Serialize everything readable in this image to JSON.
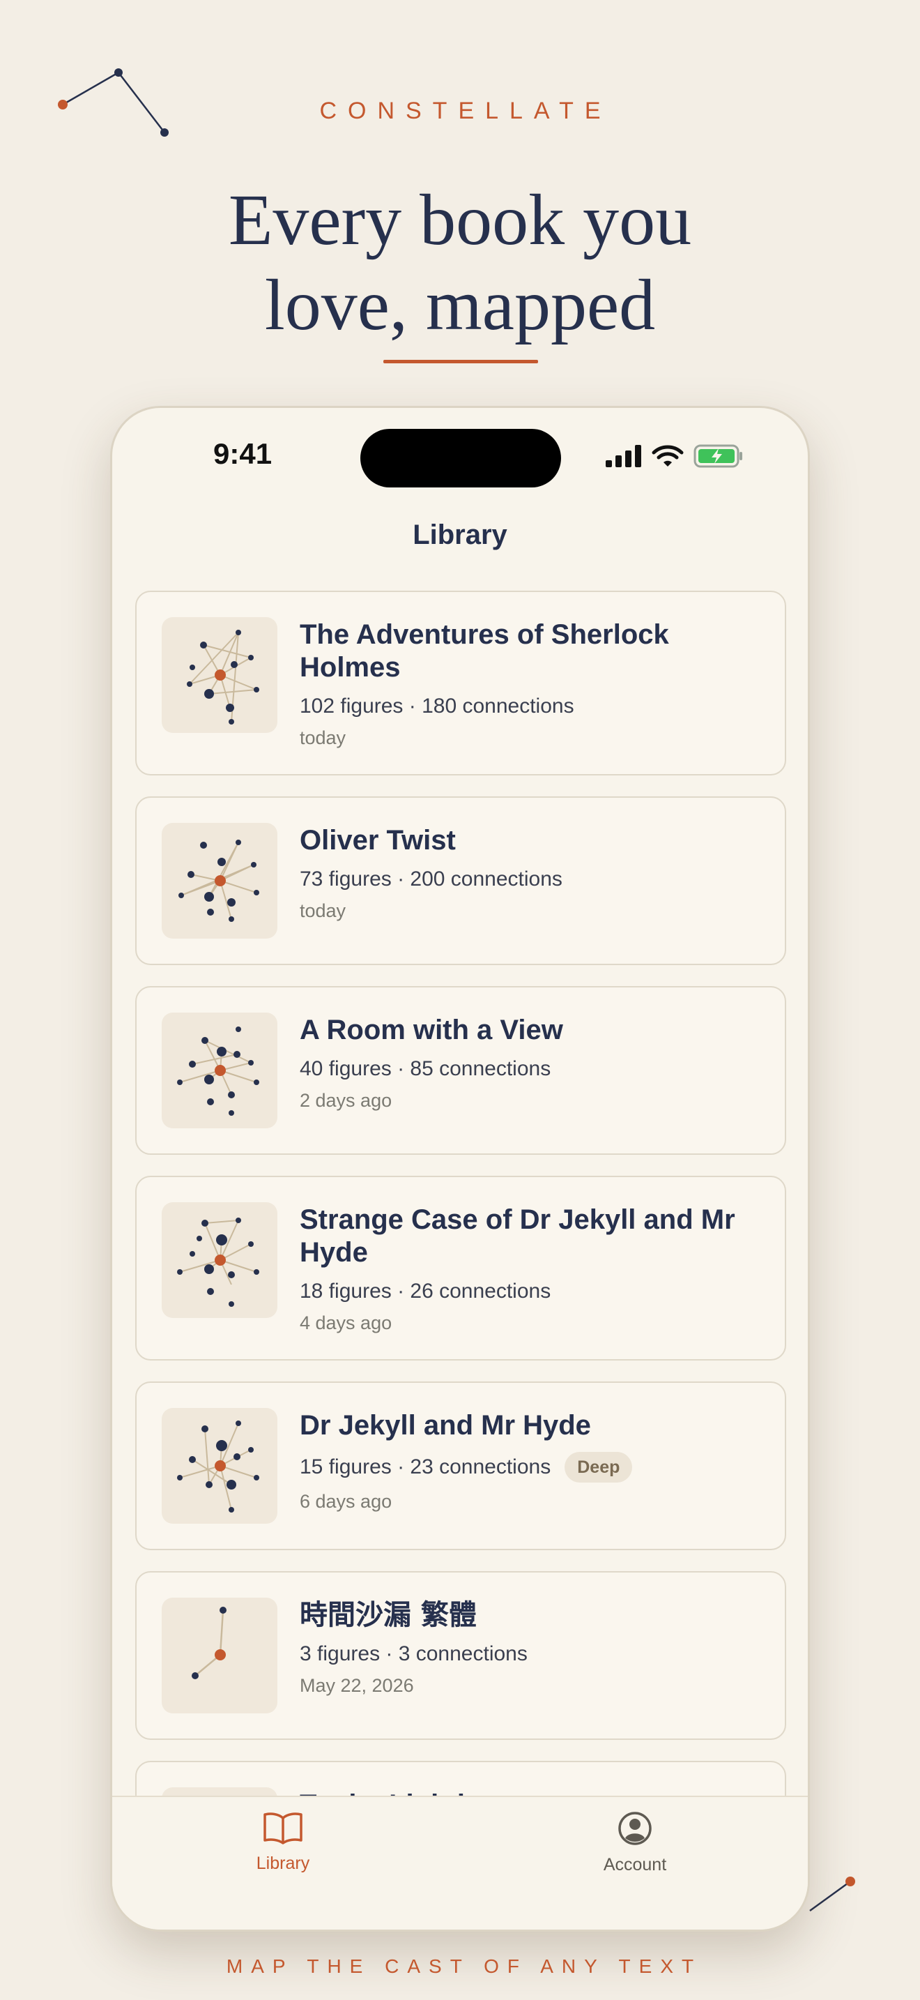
{
  "brand": "CONSTELLATE",
  "headline": {
    "line1": "Every book you",
    "line2": "love, mapped"
  },
  "tagline": "MAP THE CAST OF ANY TEXT",
  "status": {
    "time": "9:41"
  },
  "screen": {
    "title": "Library"
  },
  "books": [
    {
      "title": "The Adventures of Sherlock Holmes",
      "stats": "102 figures · 180 connections",
      "when": "today",
      "thumb": "constellation-dense"
    },
    {
      "title": "Oliver Twist",
      "stats": "73 figures · 200 connections",
      "when": "today",
      "thumb": "constellation-dense"
    },
    {
      "title": "A Room with a View",
      "stats": "40 figures · 85 connections",
      "when": "2 days ago",
      "thumb": "constellation-dense"
    },
    {
      "title": "Strange Case of Dr Jekyll and Mr Hyde",
      "stats": "18 figures · 26 connections",
      "when": "4 days ago",
      "thumb": "constellation-dense"
    },
    {
      "title": "Dr Jekyll and Mr Hyde",
      "stats": "15 figures · 23 connections",
      "badge": "Deep",
      "when": "6 days ago",
      "thumb": "constellation-dense"
    },
    {
      "title": "時間沙漏 繁體",
      "stats": "3 figures · 3 connections",
      "when": "May 22, 2026",
      "thumb": "constellation-sparse"
    },
    {
      "title": "To the Lighthouse",
      "stats": "",
      "when": "",
      "thumb": "constellation-dense"
    }
  ],
  "tabs": [
    {
      "label": "Library",
      "icon": "book-icon",
      "active": true
    },
    {
      "label": "Account",
      "icon": "person-icon",
      "active": false
    }
  ],
  "colors": {
    "accent": "#c4582e",
    "ink": "#26304d",
    "background": "#f3eee5",
    "card": "#faf6ee"
  }
}
